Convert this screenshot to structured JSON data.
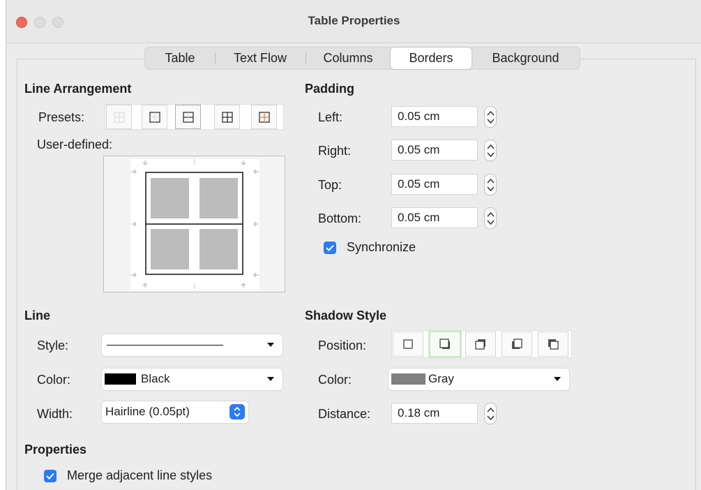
{
  "window": {
    "title": "Table Properties"
  },
  "tabs": [
    {
      "label": "Table"
    },
    {
      "label": "Text Flow"
    },
    {
      "label": "Columns"
    },
    {
      "label": "Borders",
      "active": true
    },
    {
      "label": "Background"
    }
  ],
  "line_arrangement": {
    "heading": "Line Arrangement",
    "presets_label": "Presets:",
    "user_defined_label": "User-defined:"
  },
  "padding": {
    "heading": "Padding",
    "left_label": "Left:",
    "left_value": "0.05 cm",
    "right_label": "Right:",
    "right_value": "0.05 cm",
    "top_label": "Top:",
    "top_value": "0.05 cm",
    "bottom_label": "Bottom:",
    "bottom_value": "0.05 cm",
    "synchronize_label": "Synchronize",
    "synchronize_checked": true
  },
  "line": {
    "heading": "Line",
    "style_label": "Style:",
    "color_label": "Color:",
    "color_value": "Black",
    "color_hex": "#000000",
    "width_label": "Width:",
    "width_value": "Hairline (0.05pt)"
  },
  "shadow_style": {
    "heading": "Shadow Style",
    "position_label": "Position:",
    "color_label": "Color:",
    "color_value": "Gray",
    "color_hex": "#808080",
    "distance_label": "Distance:",
    "distance_value": "0.18 cm"
  },
  "properties": {
    "heading": "Properties",
    "merge_label": "Merge adjacent line styles",
    "merge_checked": true
  },
  "colors": {
    "accent": "#2b7bf3",
    "close_button": "#ed6a5e",
    "preset_highlight": "#e8843a",
    "shadow_selected": "#cfe6cd"
  }
}
